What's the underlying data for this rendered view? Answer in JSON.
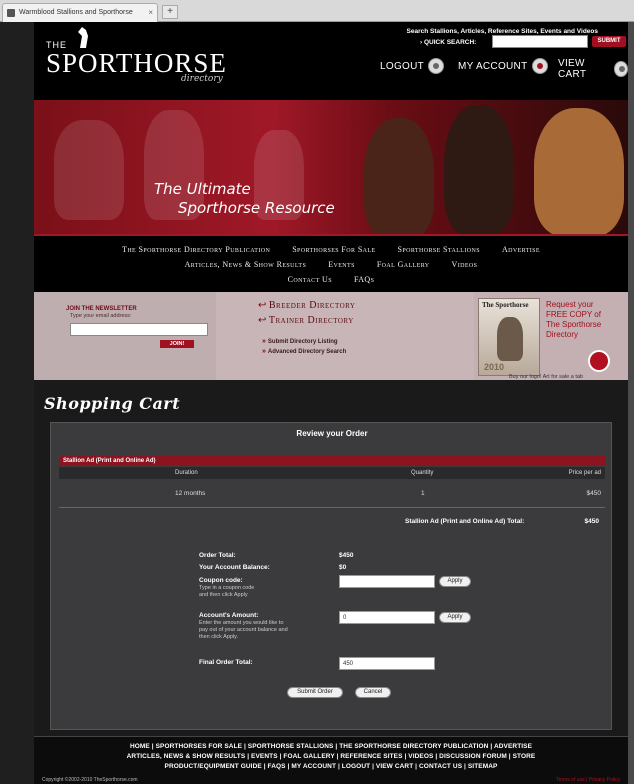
{
  "browser": {
    "tab_title": "Warmblood Stallions and Sporthorse",
    "new_tab": "+",
    "close": "×"
  },
  "header": {
    "logo_the": "THE",
    "logo_name": "SPORTHORSE",
    "logo_directory": "directory",
    "search_hint": "Search Stallions, Articles, Reference Sites, Events and Videos",
    "quick_search_label": "› QUICK SEARCH:",
    "submit_label": "SUBMIT",
    "logout": "LOGOUT",
    "my_account": "MY ACCOUNT",
    "view_cart": "VIEW CART"
  },
  "banner": {
    "line1": "The Ultimate",
    "line2": "Sporthorse Resource"
  },
  "nav": {
    "row1": [
      "The Sporthorse Directory Publication",
      "Sporthorses For Sale",
      "Sporthorse Stallions",
      "Advertise"
    ],
    "row2": [
      "Articles, News & Show Results",
      "Events",
      "Foal Gallery",
      "Videos"
    ],
    "row3": [
      "Contact Us",
      "FAQs"
    ]
  },
  "promo": {
    "newsletter_title": "JOIN THE NEWSLETTER",
    "newsletter_sub": "Type your email address:",
    "newsletter_btn": "JOIN!",
    "breeder": "Breeder Directory",
    "trainer": "Trainer Directory",
    "submit_listing": "Submit Directory Listing",
    "advanced_search": "Advanced Directory Search",
    "mag_title": "The Sporthorse",
    "mag_year": "2010",
    "request": [
      "Request your",
      "FREE COPY of",
      "The Sporthorse",
      "Directory"
    ],
    "caption": "Buy our logo! Art for sale a tab"
  },
  "cart": {
    "title": "Shopping Cart",
    "panel_title": "Review your Order",
    "item_name": "Stallion Ad (Print and Online Ad)",
    "columns": {
      "duration": "Duration",
      "quantity": "Quantity",
      "price": "Price per ad"
    },
    "row": {
      "duration": "12 months",
      "quantity": "1",
      "price": "$450"
    },
    "subtotal_label": "Stallion Ad (Print and Online Ad) Total:",
    "subtotal_value": "$450",
    "order_total_label": "Order Total:",
    "order_total_value": "$450",
    "balance_label": "Your Account Balance:",
    "balance_value": "$0",
    "coupon_label": "Coupon code:",
    "coupon_hint": [
      "Type in a coupon code",
      "and then click Apply"
    ],
    "account_label": "Account's Amount:",
    "account_hint": [
      "Enter the amount you would like to",
      "pay out of your account balance and",
      "then click Apply."
    ],
    "account_value": "0",
    "apply": "Apply",
    "final_label": "Final Order Total:",
    "final_value": "450",
    "submit_order": "Submit Order",
    "cancel": "Cancel"
  },
  "footer": {
    "line1": "HOME | SPORTHORSES FOR SALE | SPORTHORSE STALLIONS | THE SPORTHORSE DIRECTORY PUBLICATION | ADVERTISE",
    "line2": "ARTICLES, NEWS & SHOW RESULTS | EVENTS | FOAL GALLERY | REFERENCE SITES | VIDEOS | DISCUSSION FORUM | STORE",
    "line3": "PRODUCT/EQUIPMENT GUIDE | FAQS | MY ACCOUNT | LOGOUT | VIEW CART | CONTACT US | SITEMAP",
    "copyright": "Copyright ©2002-2010 TheSporthorse.com",
    "links": "Terms of use | Privacy Policy"
  },
  "colors": {
    "accent": "#a11020",
    "banner": "#a01828",
    "panel": "#3b3b3d"
  }
}
